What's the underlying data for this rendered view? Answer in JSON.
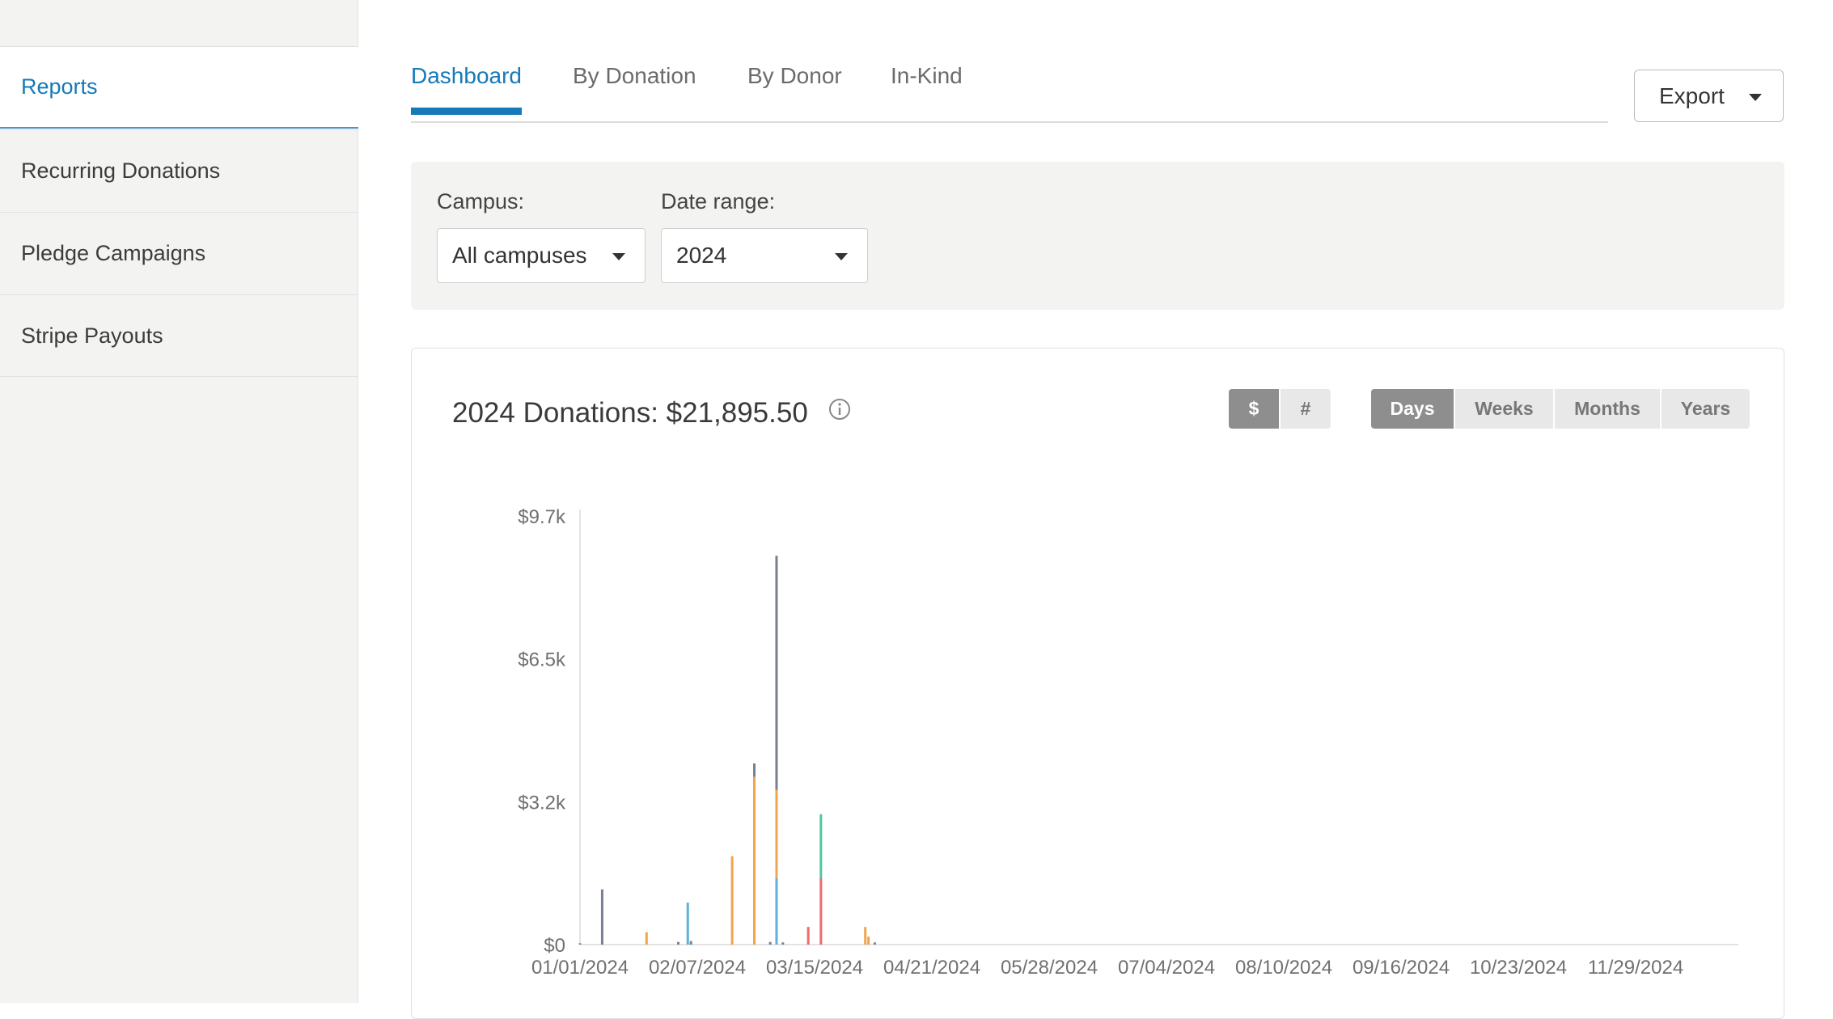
{
  "sidebar": {
    "items": [
      {
        "label": "Reports",
        "active": true
      },
      {
        "label": "Recurring Donations",
        "active": false
      },
      {
        "label": "Pledge Campaigns",
        "active": false
      },
      {
        "label": "Stripe Payouts",
        "active": false
      }
    ]
  },
  "tabs": [
    {
      "label": "Dashboard",
      "active": true
    },
    {
      "label": "By Donation",
      "active": false
    },
    {
      "label": "By Donor",
      "active": false
    },
    {
      "label": "In-Kind",
      "active": false
    }
  ],
  "export": {
    "label": "Export",
    "icon": "chevron-down-icon"
  },
  "filters": {
    "campus": {
      "label": "Campus:",
      "value": "All campuses"
    },
    "date_range": {
      "label": "Date range:",
      "value": "2024"
    }
  },
  "card": {
    "title": "2024 Donations: $21,895.50",
    "info_icon": "info-icon",
    "metric_toggle": [
      {
        "label": "$",
        "active": true
      },
      {
        "label": "#",
        "active": false
      }
    ],
    "period_toggle": [
      {
        "label": "Days",
        "active": true
      },
      {
        "label": "Weeks",
        "active": false
      },
      {
        "label": "Months",
        "active": false
      },
      {
        "label": "Years",
        "active": false
      }
    ]
  },
  "colors": {
    "accent": "#1679b8",
    "sidebar_bg": "#f3f3f2",
    "series": [
      "#7a7f92",
      "#f0a54c",
      "#5ab3d8",
      "#4ec7a3",
      "#ef6b6b"
    ]
  },
  "chart_data": {
    "type": "bar",
    "title": "",
    "xlabel": "",
    "ylabel": "",
    "ylim": [
      0,
      9700
    ],
    "y_ticks": [
      "$0",
      "$3.2k",
      "$6.5k",
      "$9.7k"
    ],
    "x_ticks": [
      "01/01/2024",
      "02/07/2024",
      "03/15/2024",
      "04/21/2024",
      "05/28/2024",
      "07/04/2024",
      "08/10/2024",
      "09/16/2024",
      "10/23/2024",
      "11/29/2024"
    ],
    "stacked": true,
    "legend": "none",
    "grid": false,
    "bars": [
      {
        "date": "01/01/2024",
        "segments": [
          {
            "value": 30,
            "color": "#7a7f92"
          }
        ]
      },
      {
        "date": "01/08/2024",
        "segments": [
          {
            "value": 1250,
            "color": "#7a7f92"
          }
        ]
      },
      {
        "date": "01/22/2024",
        "segments": [
          {
            "value": 280,
            "color": "#f0a54c"
          }
        ]
      },
      {
        "date": "02/01/2024",
        "segments": [
          {
            "value": 60,
            "color": "#7a7f92"
          }
        ]
      },
      {
        "date": "02/04/2024",
        "segments": [
          {
            "value": 950,
            "color": "#5ab3d8"
          }
        ]
      },
      {
        "date": "02/05/2024",
        "segments": [
          {
            "value": 80,
            "color": "#7a7f92"
          }
        ]
      },
      {
        "date": "02/18/2024",
        "segments": [
          {
            "value": 2000,
            "color": "#f0a54c"
          }
        ]
      },
      {
        "date": "02/25/2024",
        "segments": [
          {
            "value": 3800,
            "color": "#f0a54c"
          },
          {
            "value": 300,
            "color": "#7a7f92"
          }
        ]
      },
      {
        "date": "03/01/2024",
        "segments": [
          {
            "value": 60,
            "color": "#7a7f92"
          }
        ]
      },
      {
        "date": "03/03/2024",
        "segments": [
          {
            "value": 1500,
            "color": "#5ab3d8"
          },
          {
            "value": 2000,
            "color": "#f0a54c"
          },
          {
            "value": 5300,
            "color": "#7a7f92"
          }
        ]
      },
      {
        "date": "03/05/2024",
        "segments": [
          {
            "value": 50,
            "color": "#7a7f92"
          }
        ]
      },
      {
        "date": "03/13/2024",
        "segments": [
          {
            "value": 400,
            "color": "#ef6b6b"
          }
        ]
      },
      {
        "date": "03/17/2024",
        "segments": [
          {
            "value": 1500,
            "color": "#ef6b6b"
          },
          {
            "value": 1450,
            "color": "#4ec7a3"
          }
        ]
      },
      {
        "date": "03/31/2024",
        "segments": [
          {
            "value": 400,
            "color": "#f0a54c"
          }
        ]
      },
      {
        "date": "04/01/2024",
        "segments": [
          {
            "value": 180,
            "color": "#f0a54c"
          }
        ]
      },
      {
        "date": "04/03/2024",
        "segments": [
          {
            "value": 50,
            "color": "#7a7f92"
          }
        ]
      }
    ]
  }
}
